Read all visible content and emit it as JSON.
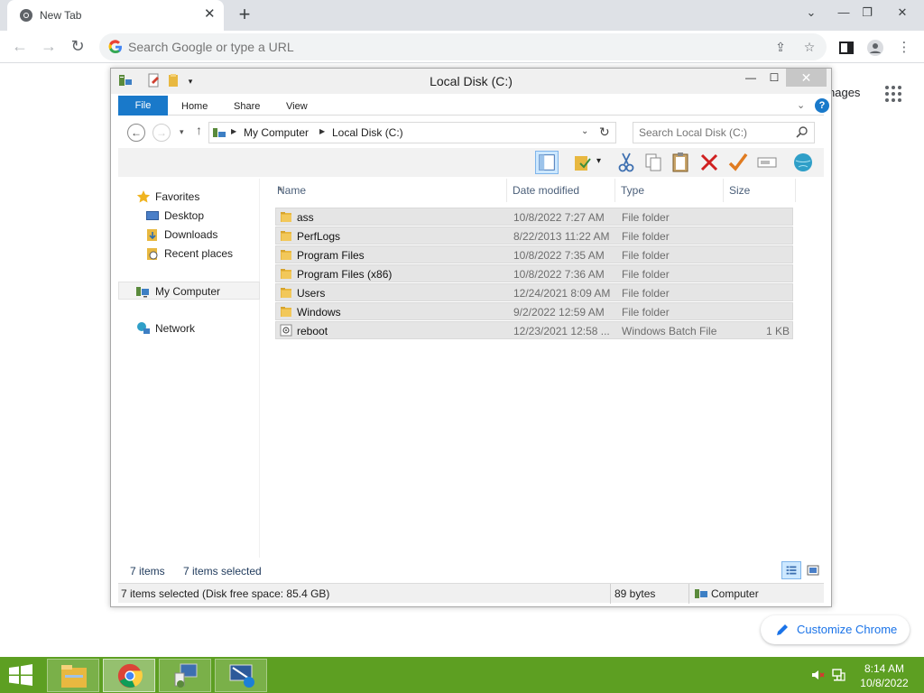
{
  "browser": {
    "tab_title": "New Tab",
    "close_tab": "✕",
    "new_tab": "+",
    "omnibox_placeholder": "Search Google or type a URL",
    "ntp_images_partial": "nages",
    "customize_label": "Customize Chrome"
  },
  "window": {
    "title": "Local Disk (C:)",
    "ribbon_tabs": [
      "File",
      "Home",
      "Share",
      "View"
    ],
    "address": {
      "segments": [
        "My Computer",
        "Local Disk (C:)"
      ],
      "search_placeholder": "Search Local Disk (C:)"
    },
    "nav": {
      "favorites": "Favorites",
      "desktop": "Desktop",
      "downloads": "Downloads",
      "recent": "Recent places",
      "my_computer": "My Computer",
      "network": "Network"
    },
    "columns": [
      "Name",
      "Date modified",
      "Type",
      "Size"
    ],
    "files": [
      {
        "name": "ass",
        "date": "10/8/2022 7:27 AM",
        "type": "File folder",
        "size": "",
        "icon": "folder-icon"
      },
      {
        "name": "PerfLogs",
        "date": "8/22/2013 11:22 AM",
        "type": "File folder",
        "size": "",
        "icon": "folder-icon"
      },
      {
        "name": "Program Files",
        "date": "10/8/2022 7:35 AM",
        "type": "File folder",
        "size": "",
        "icon": "folder-icon"
      },
      {
        "name": "Program Files (x86)",
        "date": "10/8/2022 7:36 AM",
        "type": "File folder",
        "size": "",
        "icon": "folder-icon"
      },
      {
        "name": "Users",
        "date": "12/24/2021 8:09 AM",
        "type": "File folder",
        "size": "",
        "icon": "folder-icon"
      },
      {
        "name": "Windows",
        "date": "9/2/2022 12:59 AM",
        "type": "File folder",
        "size": "",
        "icon": "folder-icon"
      },
      {
        "name": "reboot",
        "date": "12/23/2021 12:58 ...",
        "type": "Windows Batch File",
        "size": "1 KB",
        "icon": "batch-file-icon"
      }
    ],
    "counts": {
      "items": "7 items",
      "selected": "7 items selected"
    },
    "status": {
      "selection": "7 items selected (Disk free space: 85.4 GB)",
      "bytes": "89 bytes",
      "location": "Computer"
    }
  },
  "taskbar": {
    "time": "8:14 AM",
    "date": "10/8/2022"
  },
  "colors": {
    "ribbon_file": "#1979ca",
    "taskbar": "#5d9f22",
    "folder": "#e8b840",
    "selection_row": "#e5e5e5"
  }
}
